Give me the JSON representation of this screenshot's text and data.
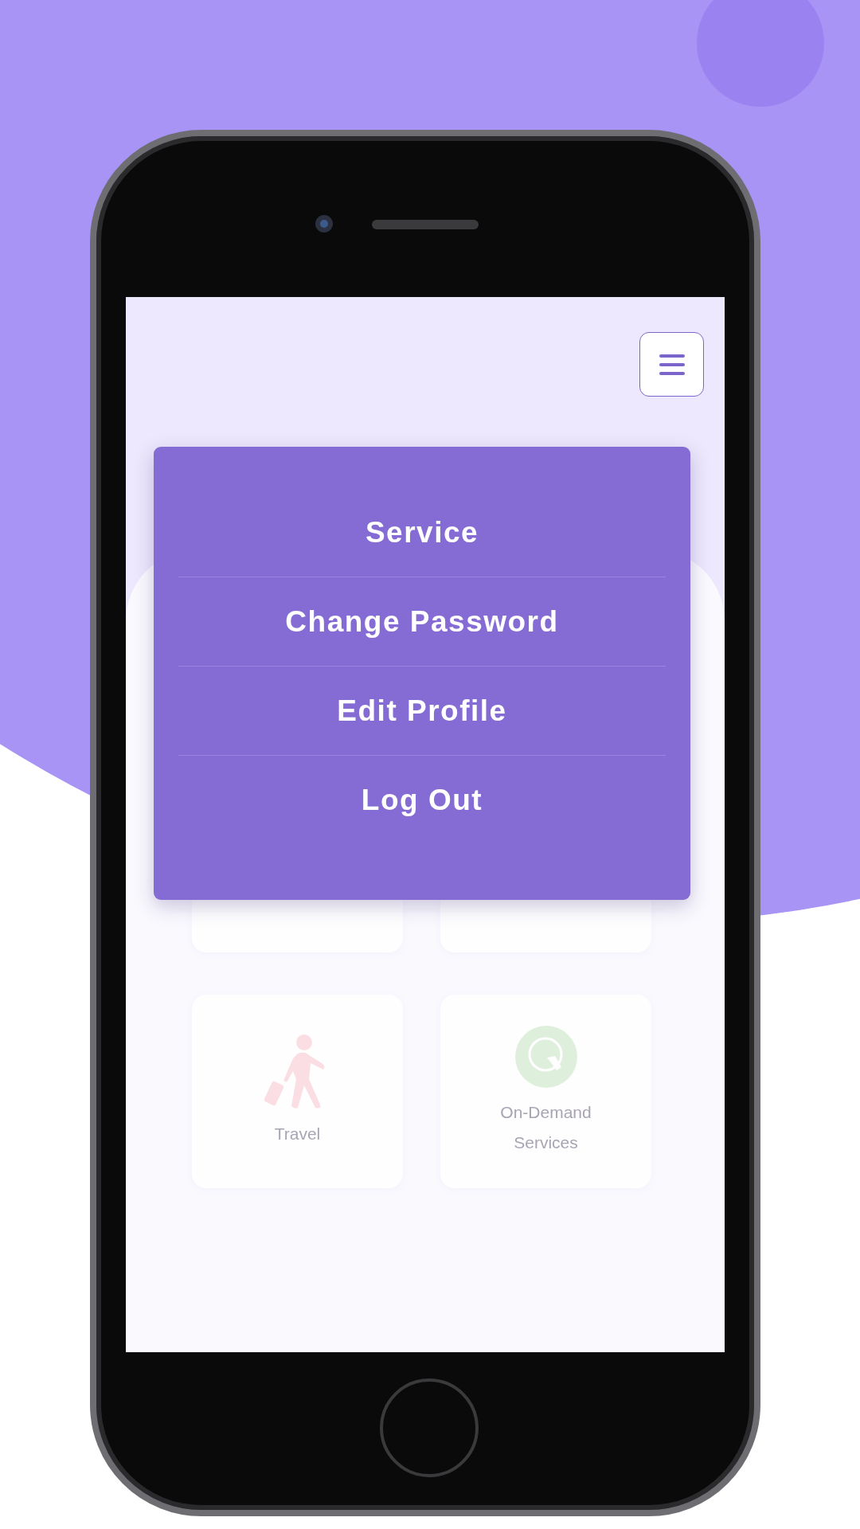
{
  "menu": {
    "items": [
      {
        "label": "Service"
      },
      {
        "label": "Change Password"
      },
      {
        "label": "Edit Profile"
      },
      {
        "label": "Log Out"
      }
    ]
  },
  "cards": [
    {
      "kind": "covered"
    },
    {
      "kind": "covered"
    },
    {
      "kind": "travel",
      "label": "Travel"
    },
    {
      "kind": "on_demand",
      "label": "On-Demand Services"
    }
  ]
}
